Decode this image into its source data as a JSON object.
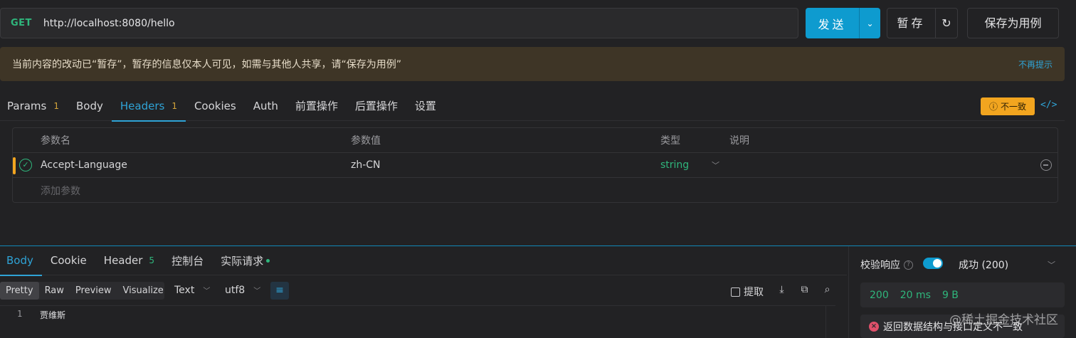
{
  "request": {
    "method": "GET",
    "url": "http://localhost:8080/hello",
    "send_label": "发送",
    "save_temp_label": "暂存",
    "save_case_label": "保存为用例"
  },
  "notice": {
    "text": "当前内容的改动已“暂存”，暂存的信息仅本人可见，如需与其他人共享，请“保存为用例”",
    "dismiss": "不再提示"
  },
  "request_tabs": [
    {
      "label": "Params",
      "count": "1"
    },
    {
      "label": "Body",
      "count": ""
    },
    {
      "label": "Headers",
      "count": "1"
    },
    {
      "label": "Cookies",
      "count": ""
    },
    {
      "label": "Auth",
      "count": ""
    },
    {
      "label": "前置操作",
      "count": ""
    },
    {
      "label": "后置操作",
      "count": ""
    },
    {
      "label": "设置",
      "count": ""
    }
  ],
  "mismatch_badge": "不一致",
  "params_table": {
    "columns": [
      "参数名",
      "参数值",
      "类型",
      "说明"
    ],
    "rows": [
      {
        "name": "Accept-Language",
        "value": "zh-CN",
        "type": "string",
        "description": ""
      }
    ],
    "add_placeholder": "添加参数"
  },
  "response": {
    "tabs": [
      {
        "label": "Body",
        "count": ""
      },
      {
        "label": "Cookie",
        "count": ""
      },
      {
        "label": "Header",
        "count": "5"
      },
      {
        "label": "控制台",
        "count": ""
      },
      {
        "label": "实际请求",
        "count": ""
      }
    ],
    "formats": [
      "Pretty",
      "Raw",
      "Preview",
      "Visualize"
    ],
    "content_type": "Text",
    "encoding": "utf8",
    "extract_label": "提取",
    "lines": [
      {
        "num": "1",
        "text": "贾维斯"
      }
    ]
  },
  "validation": {
    "label": "校验响应",
    "result": "成功 (200)",
    "status": "200",
    "time": "20 ms",
    "size": "9 B",
    "error": "返回数据结构与接口定义不一致"
  },
  "watermark": "@稀土掘金技术社区",
  "colors": {
    "accent": "#2fa3d6",
    "send_button": "#0e9bcf",
    "success_green": "#2fb67c",
    "warning_orange": "#f2a51f",
    "error_red": "#e0506a"
  }
}
